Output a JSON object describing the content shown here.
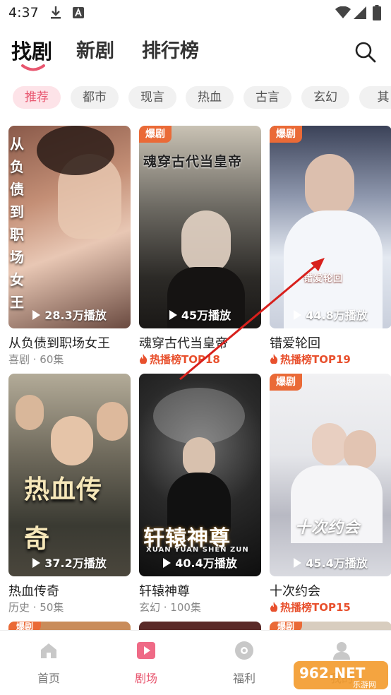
{
  "status_bar": {
    "time": "4:37"
  },
  "top_tabs": [
    {
      "label": "找剧",
      "active": true
    },
    {
      "label": "新剧",
      "active": false
    },
    {
      "label": "排行榜",
      "active": false
    }
  ],
  "chips": [
    {
      "label": "推荐",
      "active": true
    },
    {
      "label": "都市"
    },
    {
      "label": "现言"
    },
    {
      "label": "热血"
    },
    {
      "label": "古言"
    },
    {
      "label": "玄幻"
    },
    {
      "label": "其"
    }
  ],
  "dramas": [
    {
      "poster_text": "从负债到职场女王",
      "plays": "28.3万播放",
      "title": "从负债到职场女王",
      "meta": "喜剧 · 60集",
      "badge": "",
      "hot": ""
    },
    {
      "poster_text": "魂穿古代当皇帝",
      "plays": "45万播放",
      "title": "魂穿古代当皇帝",
      "meta": "",
      "badge": "爆剧",
      "hot": "热播榜TOP18"
    },
    {
      "poster_text": "错爱轮回",
      "plays": "44.8万播放",
      "title": "错爱轮回",
      "meta": "",
      "badge": "爆剧",
      "hot": "热播榜TOP19"
    },
    {
      "poster_text": "热血传奇",
      "plays": "37.2万播放",
      "title": "热血传奇",
      "meta": "历史 · 50集",
      "badge": "",
      "hot": ""
    },
    {
      "poster_text": "轩辕神尊",
      "poster_sub": "XUAN YUAN SHEN ZUN",
      "plays": "40.4万播放",
      "title": "轩辕神尊",
      "meta": "玄幻 · 100集",
      "badge": "",
      "hot": ""
    },
    {
      "poster_text": "十次约会",
      "plays": "45.4万播放",
      "title": "十次约会",
      "meta": "",
      "badge": "爆剧",
      "hot": "热播榜TOP15"
    }
  ],
  "peek_badges": [
    "爆剧",
    "爆剧"
  ],
  "bottom_nav": [
    {
      "label": "首页",
      "icon": "home-icon"
    },
    {
      "label": "剧场",
      "icon": "play-icon",
      "active": true
    },
    {
      "label": "福利",
      "icon": "gift-icon"
    },
    {
      "label": "我的",
      "icon": "user-icon"
    }
  ],
  "watermark": "962.NET 乐游网",
  "colors": {
    "accent": "#e8566f",
    "badge": "#ea6a37",
    "hot": "#e8502d"
  }
}
